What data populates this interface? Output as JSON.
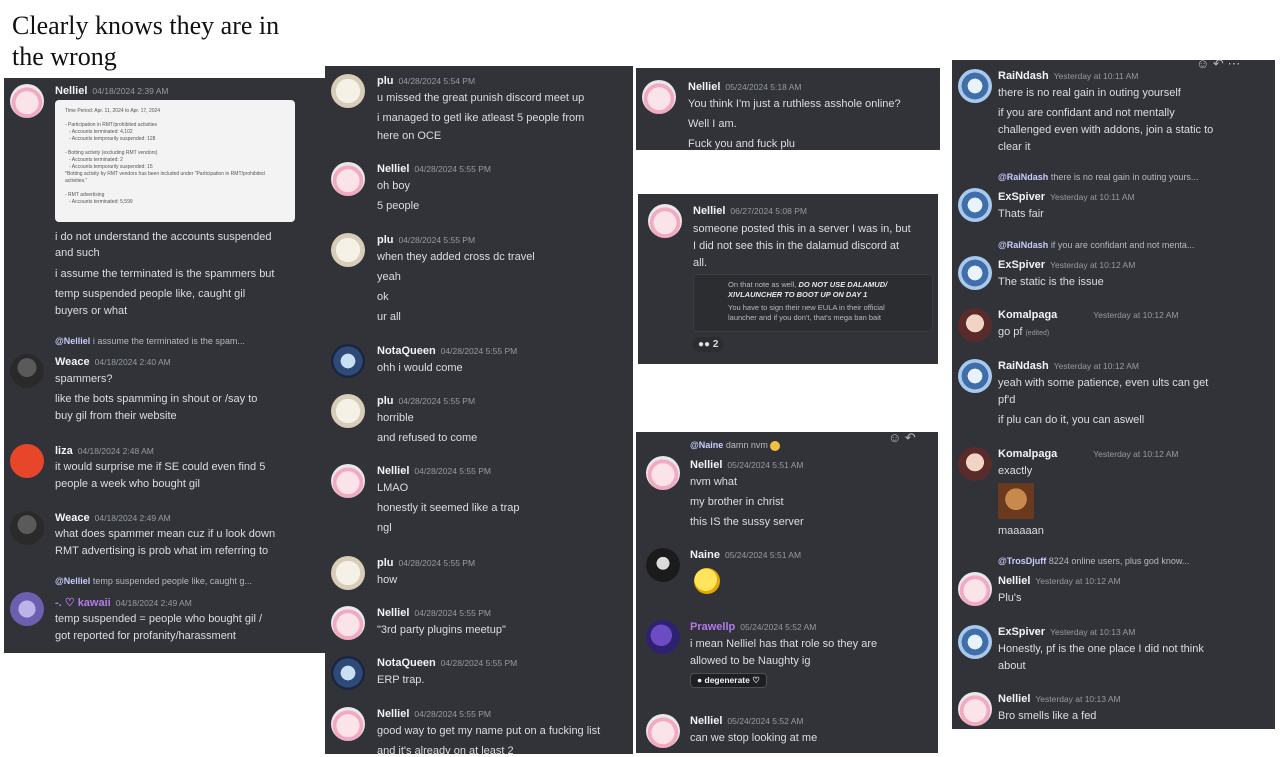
{
  "caption": "Clearly knows they are in the wrong",
  "panel1": {
    "m1": {
      "name": "Nelliel",
      "time": "04/18/2024 2:39 AM",
      "doc": {
        "l1": "Time Period: Apr. 11, 2024 to Apr. 17, 2024",
        "l2": "- Participation in RMT/prohibited activities",
        "l3": "- Accounts terminated: 4,102",
        "l4": "- Accounts temporarily suspended: 128",
        "l5": "- Botting activity (excluding RMT vendors)",
        "l6": "- Accounts terminated: 2",
        "l7": "- Accounts temporarily suspended: 15",
        "l8": "*Botting activity by RMT vendors has been included under \"Participation in RMT/prohibited activities.\"",
        "l9": "- RMT advertising",
        "l10": "- Accounts terminated: 5,599"
      },
      "lines": [
        "i do not understand the accounts suspended",
        "and such",
        "i assume the terminated is the spammers but",
        "temp suspended people like, caught gil",
        "buyers or what"
      ]
    },
    "m2": {
      "reply_name": "@Nelliel",
      "reply_text": "i assume the terminated is the spam...",
      "name": "Weace",
      "time": "04/18/2024 2:40 AM",
      "lines": [
        "spammers?",
        "like the bots spamming in shout or /say to",
        "buy gil from their website"
      ]
    },
    "m3": {
      "name": "liza",
      "time": "04/18/2024 2:48 AM",
      "lines": [
        "it would surprise me if SE could even find 5",
        "people a week who bought gil"
      ]
    },
    "m4": {
      "name": "Weace",
      "time": "04/18/2024 2:49 AM",
      "lines": [
        "what does spammer mean cuz if u look down",
        "RMT advertising is prob what im referring to"
      ]
    },
    "m5": {
      "reply_name": "@Nelliel",
      "reply_text": "temp suspended people like, caught g...",
      "name": "-. ♡ kawaii",
      "time": "04/18/2024 2:49 AM",
      "lines": [
        "temp suspended = people who bought gil /",
        "got reported for profanity/harassment"
      ]
    }
  },
  "panel2": {
    "m1": {
      "name": "plu",
      "time": "04/28/2024 5:54 PM",
      "lines": [
        "u missed the great punish discord meet up",
        "i managed to getl ike atleast 5 people from",
        "here on OCE"
      ]
    },
    "m2": {
      "name": "Nelliel",
      "time": "04/28/2024 5:55 PM",
      "lines": [
        "oh boy",
        "5 people"
      ]
    },
    "m3": {
      "name": "plu",
      "time": "04/28/2024 5:55 PM",
      "lines": [
        "when they added cross dc travel",
        "yeah",
        "ok",
        "ur all"
      ]
    },
    "m4": {
      "name": "NotaQueen",
      "time": "04/28/2024 5:55 PM",
      "lines": [
        "ohh i would come"
      ]
    },
    "m5": {
      "name": "plu",
      "time": "04/28/2024 5:55 PM",
      "lines": [
        "horrible",
        "and refused to come"
      ]
    },
    "m6": {
      "name": "Nelliel",
      "time": "04/28/2024 5:55 PM",
      "lines": [
        "LMAO",
        "honestly it seemed like a trap",
        "ngl"
      ]
    },
    "m7": {
      "name": "plu",
      "time": "04/28/2024 5:55 PM",
      "lines": [
        "how"
      ]
    },
    "m8": {
      "name": "Nelliel",
      "time": "04/28/2024 5:55 PM",
      "lines": [
        "\"3rd party plugins meetup\""
      ]
    },
    "m9": {
      "name": "NotaQueen",
      "time": "04/28/2024 5:55 PM",
      "lines": [
        "ERP trap."
      ]
    },
    "m10": {
      "name": "Nelliel",
      "time": "04/28/2024 5:55 PM",
      "lines": [
        "good way to get my name put on a fucking list",
        "and it's already on at least 2"
      ]
    }
  },
  "panel3a": {
    "m1": {
      "name": "Nelliel",
      "time": "05/24/2024 5:18 AM",
      "lines": [
        "You think I'm just a ruthless asshole online?",
        "Well I am.",
        "Fuck you and fuck plu"
      ]
    }
  },
  "panel3b": {
    "m1": {
      "name": "Nelliel",
      "time": "06/27/2024 5:08 PM",
      "lines": [
        "someone posted this in a server I was in, but",
        "I did not see this in the dalamud discord at",
        "all."
      ],
      "embed_bold": "DO NOT USE DALAMUD/ XIVLAUNCHER TO BOOT UP ON DAY 1",
      "embed_pre": "On that note as well, ",
      "embed_l1": "You have to sign their new EULA in their official",
      "embed_l2": "launcher and if you don't, that's mega ban bait",
      "reaction": "2"
    }
  },
  "panel3c": {
    "m1": {
      "reply_name": "@Naine",
      "reply_text": "damn nvm",
      "name": "Nelliel",
      "time": "05/24/2024 5:51 AM",
      "lines": [
        "nvm what",
        "my brother in christ",
        "this IS the sussy server"
      ]
    },
    "m2": {
      "name": "Naine",
      "time": "05/24/2024 5:51 AM"
    },
    "m3": {
      "name": "Prawellp",
      "time": "05/24/2024 5:52 AM",
      "lines": [
        "i mean Nelliel has that role so they are",
        "allowed to be Naughty ig"
      ],
      "pill": "degenerate ♡"
    },
    "m4": {
      "name": "Nelliel",
      "time": "05/24/2024 5:52 AM",
      "lines": [
        "can we stop looking at me"
      ]
    }
  },
  "panel4": {
    "m1": {
      "name": "RaiNdash",
      "time": "Yesterday at 10:11 AM",
      "lines": [
        "there is no real gain in outing yourself",
        "if you are confidant and not mentally",
        "challenged even with addons, join a static to",
        "clear it"
      ]
    },
    "m2": {
      "reply_name": "@RaiNdash",
      "reply_text": "there is no real gain in outing yours...",
      "name": "ExSpiver",
      "time": "Yesterday at 10:11 AM",
      "lines": [
        "Thats fair"
      ]
    },
    "m3": {
      "reply_name": "@RaiNdash",
      "reply_text": "if you are confidant and not menta...",
      "name": "ExSpiver",
      "time": "Yesterday at 10:12 AM",
      "lines": [
        "The static is the issue"
      ]
    },
    "m4": {
      "name": "Komalpaga",
      "time": "Yesterday at 10:12 AM",
      "lines": [
        "go pf"
      ],
      "edited": "(edited)"
    },
    "m5": {
      "name": "RaiNdash",
      "time": "Yesterday at 10:12 AM",
      "lines": [
        "yeah with some patience, even ults can get",
        "pf'd",
        "if plu can do it, you can aswell"
      ]
    },
    "m6": {
      "name": "Komalpaga",
      "time": "Yesterday at 10:12 AM",
      "lines": [
        "exactly",
        "maaaaan"
      ]
    },
    "m7": {
      "reply_name": "@TrosDjuff",
      "reply_text": "8224 online users, plus god know...",
      "name": "Nelliel",
      "time": "Yesterday at 10:12 AM",
      "lines": [
        "Plu's"
      ]
    },
    "m8": {
      "name": "ExSpiver",
      "time": "Yesterday at 10:13 AM",
      "lines": [
        "Honestly, pf is the one place I did not think",
        "about"
      ]
    },
    "m9": {
      "name": "Nelliel",
      "time": "Yesterday at 10:13 AM",
      "lines": [
        "Bro smells like a fed"
      ]
    }
  }
}
